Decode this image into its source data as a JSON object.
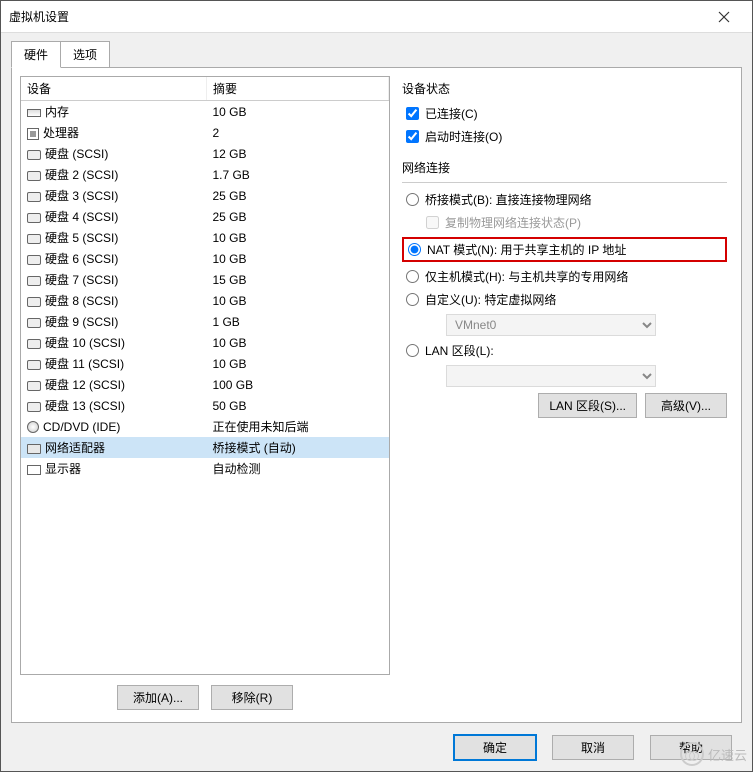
{
  "window": {
    "title": "虚拟机设置"
  },
  "tabs": {
    "hardware": "硬件",
    "options": "选项"
  },
  "table": {
    "col_device": "设备",
    "col_summary": "摘要",
    "rows": [
      {
        "icon": "mem",
        "name": "内存",
        "summary": "10 GB"
      },
      {
        "icon": "cpu",
        "name": "处理器",
        "summary": "2"
      },
      {
        "icon": "disk",
        "name": "硬盘 (SCSI)",
        "summary": "12 GB"
      },
      {
        "icon": "disk",
        "name": "硬盘 2 (SCSI)",
        "summary": "1.7 GB"
      },
      {
        "icon": "disk",
        "name": "硬盘 3 (SCSI)",
        "summary": "25 GB"
      },
      {
        "icon": "disk",
        "name": "硬盘 4 (SCSI)",
        "summary": "25 GB"
      },
      {
        "icon": "disk",
        "name": "硬盘 5 (SCSI)",
        "summary": "10 GB"
      },
      {
        "icon": "disk",
        "name": "硬盘 6 (SCSI)",
        "summary": "10 GB"
      },
      {
        "icon": "disk",
        "name": "硬盘 7 (SCSI)",
        "summary": "15 GB"
      },
      {
        "icon": "disk",
        "name": "硬盘 8 (SCSI)",
        "summary": "10 GB"
      },
      {
        "icon": "disk",
        "name": "硬盘 9 (SCSI)",
        "summary": "1 GB"
      },
      {
        "icon": "disk",
        "name": "硬盘 10 (SCSI)",
        "summary": "10 GB"
      },
      {
        "icon": "disk",
        "name": "硬盘 11 (SCSI)",
        "summary": "10 GB"
      },
      {
        "icon": "disk",
        "name": "硬盘 12 (SCSI)",
        "summary": "100 GB"
      },
      {
        "icon": "disk",
        "name": "硬盘 13 (SCSI)",
        "summary": "50 GB"
      },
      {
        "icon": "cd",
        "name": "CD/DVD (IDE)",
        "summary": "正在使用未知后端"
      },
      {
        "icon": "net",
        "name": "网络适配器",
        "summary": "桥接模式 (自动)",
        "selected": true
      },
      {
        "icon": "display",
        "name": "显示器",
        "summary": "自动检测"
      }
    ]
  },
  "buttons": {
    "add": "添加(A)...",
    "remove": "移除(R)",
    "lan_segments": "LAN 区段(S)...",
    "advanced": "高级(V)...",
    "ok": "确定",
    "cancel": "取消",
    "help": "帮助"
  },
  "status_group": {
    "title": "设备状态",
    "connected": "已连接(C)",
    "connect_at_power_on": "启动时连接(O)"
  },
  "network_group": {
    "title": "网络连接",
    "bridged": "桥接模式(B): 直接连接物理网络",
    "replicate": "复制物理网络连接状态(P)",
    "nat": "NAT 模式(N): 用于共享主机的 IP 地址",
    "hostonly": "仅主机模式(H): 与主机共享的专用网络",
    "custom": "自定义(U): 特定虚拟网络",
    "custom_value": "VMnet0",
    "lan_segment": "LAN 区段(L):",
    "lan_value": ""
  },
  "watermark": "亿速云"
}
